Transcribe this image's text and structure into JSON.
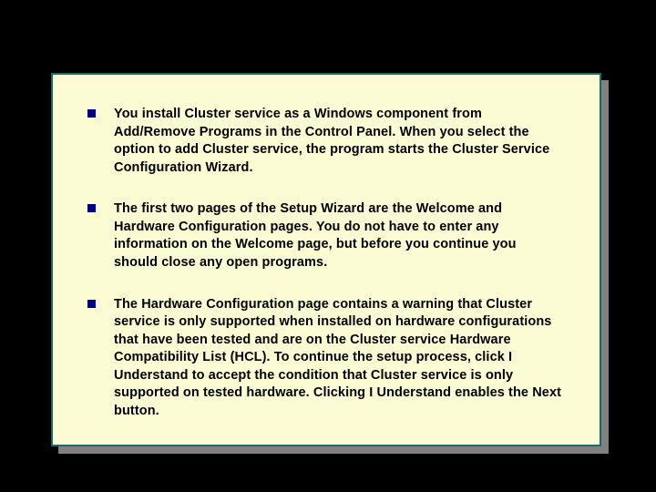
{
  "bullets": [
    {
      "text": "You install Cluster service as a Windows component from Add/Remove Programs in the Control Panel. When you select the option to add Cluster service, the program starts the Cluster Service Configuration Wizard."
    },
    {
      "text": "The first two pages of the Setup Wizard are the Welcome and Hardware Configuration pages. You do not have to enter any information on the Welcome page, but before you continue you should close any open programs."
    },
    {
      "text": "The Hardware Configuration page contains a warning that Cluster service is only supported when installed on hardware configurations that have been tested and are on the Cluster service Hardware Compatibility List (HCL). To continue the setup process, click I Understand to accept the condition that Cluster service is only supported on tested hardware. Clicking I Understand enables the Next button."
    }
  ]
}
